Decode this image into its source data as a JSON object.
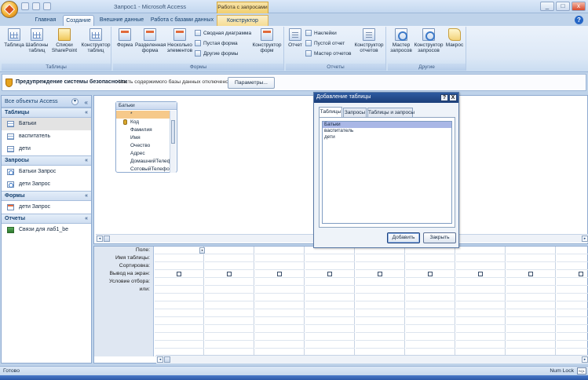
{
  "window": {
    "title": "Запрос1 - Microsoft Access",
    "context_title": "Работа с запросами",
    "minimize": "_",
    "maximize": "□",
    "close": "x"
  },
  "tabs": {
    "home": "Главная",
    "create": "Создание",
    "external": "Внешние данные",
    "db_tools": "Работа с базами данных",
    "designer": "Конструктор"
  },
  "help_label": "?",
  "ribbon": {
    "tables_group": "Таблицы",
    "forms_group": "Формы",
    "reports_group": "Отчеты",
    "other_group": "Другие",
    "table": "Таблица",
    "templates_1": "Шаблоны",
    "templates_2": "таблиц",
    "sharepoint_1": "Списки",
    "sharepoint_2": "SharePoint",
    "table_designer_1": "Конструктор",
    "table_designer_2": "таблиц",
    "form": "Форма",
    "split_form_1": "Разделенная",
    "split_form_2": "форма",
    "multi_items_1": "Несколько",
    "multi_items_2": "элементов",
    "pivot_chart": "Сводная диаграмма",
    "blank_form": "Пустая форма",
    "more_forms": "Другие формы",
    "form_designer_1": "Конструктор",
    "form_designer_2": "форм",
    "report": "Отчет",
    "labels": "Наклейки",
    "blank_report": "Пустой отчет",
    "report_wizard": "Мастер отчетов",
    "report_designer_1": "Конструктор",
    "report_designer_2": "отчетов",
    "query_wizard_1": "Мастер",
    "query_wizard_2": "запросов",
    "query_designer_1": "Конструктор",
    "query_designer_2": "запросов",
    "macro": "Макрос"
  },
  "security": {
    "title": "Предупреждение системы безопасности",
    "message": "Часть содержимого базы данных отключено",
    "button": "Параметры..."
  },
  "nav": {
    "header": "Все объекты Access",
    "dd_glyph": "▾",
    "collapse_glyph": "«",
    "chev_glyph": "«",
    "tables_title": "Таблицы",
    "queries_title": "Запросы",
    "forms_title": "Формы",
    "reports_title": "Отчеты",
    "tables": [
      "Батьки",
      "васпитатель",
      "дети"
    ],
    "queries": [
      "Батьки Запрос",
      "дети Запрос"
    ],
    "forms": [
      "дети Запрос"
    ],
    "reports": [
      "Связи для лаб1_be"
    ]
  },
  "field_list": {
    "title": "Батьки",
    "fields": [
      "*",
      "Код",
      "Фамилия",
      "Имя",
      "Очество",
      "Адрес",
      "ДомашнийТелеф",
      "СотовыйТелефон"
    ]
  },
  "grid": {
    "labels": [
      "Поле:",
      "Имя таблицы:",
      "Сортировка:",
      "Вывод на экран:",
      "Условие отбора:",
      "или:"
    ],
    "dd_glyph": "▾"
  },
  "dialog": {
    "title": "Добавление таблицы",
    "help": "?",
    "close": "X",
    "tabs": [
      "Таблицы",
      "Запросы",
      "Таблицы и запросы"
    ],
    "items": [
      "Батьки",
      "васпитатель",
      "дети"
    ],
    "add": "Добавить",
    "close_btn": "Закрыть"
  },
  "scroll": {
    "left": "◂",
    "right": "▸"
  },
  "status": {
    "left": "Готово",
    "right": "Num Lock",
    "sql": "SQL"
  }
}
